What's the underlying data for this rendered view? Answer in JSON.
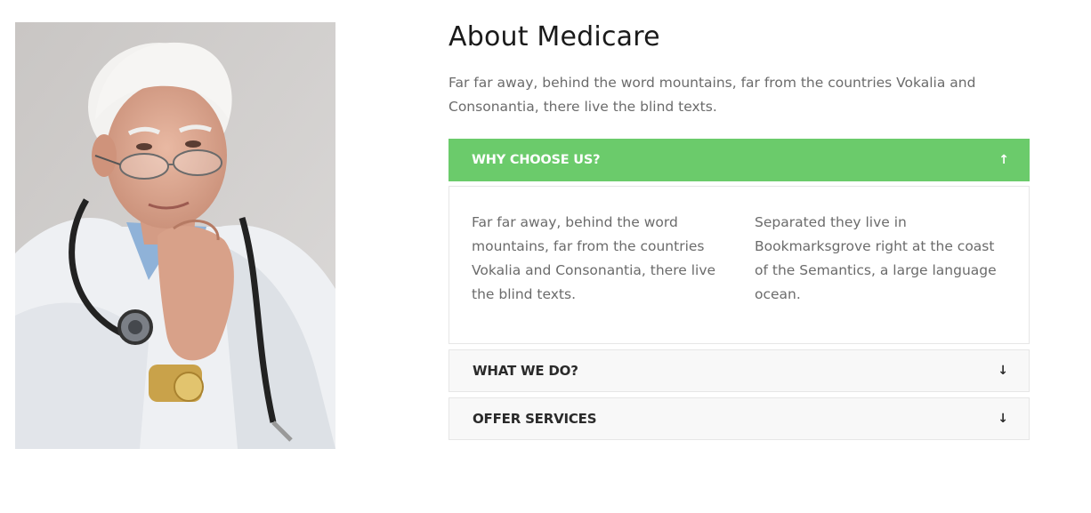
{
  "image": {
    "alt": "Doctor with stethoscope",
    "icon": "doctor-photo"
  },
  "about": {
    "title": "About Medicare",
    "intro": "Far far away, behind the word mountains, far from the countries Vokalia and Consonantia, there live the blind texts."
  },
  "accordion": {
    "colors": {
      "active_bg": "#6bcb6b",
      "closed_bg": "#f8f8f8"
    },
    "items": [
      {
        "label": "WHY CHOOSE US?",
        "arrow": "↑",
        "expanded": true,
        "col1": "Far far away, behind the word mountains, far from the countries Vokalia and Consonantia, there live the blind texts.",
        "col2": "Separated they live in Bookmarksgrove right at the coast of the Semantics, a large language ocean."
      },
      {
        "label": "WHAT WE DO?",
        "arrow": "↓",
        "expanded": false
      },
      {
        "label": "OFFER SERVICES",
        "arrow": "↓",
        "expanded": false
      }
    ]
  }
}
